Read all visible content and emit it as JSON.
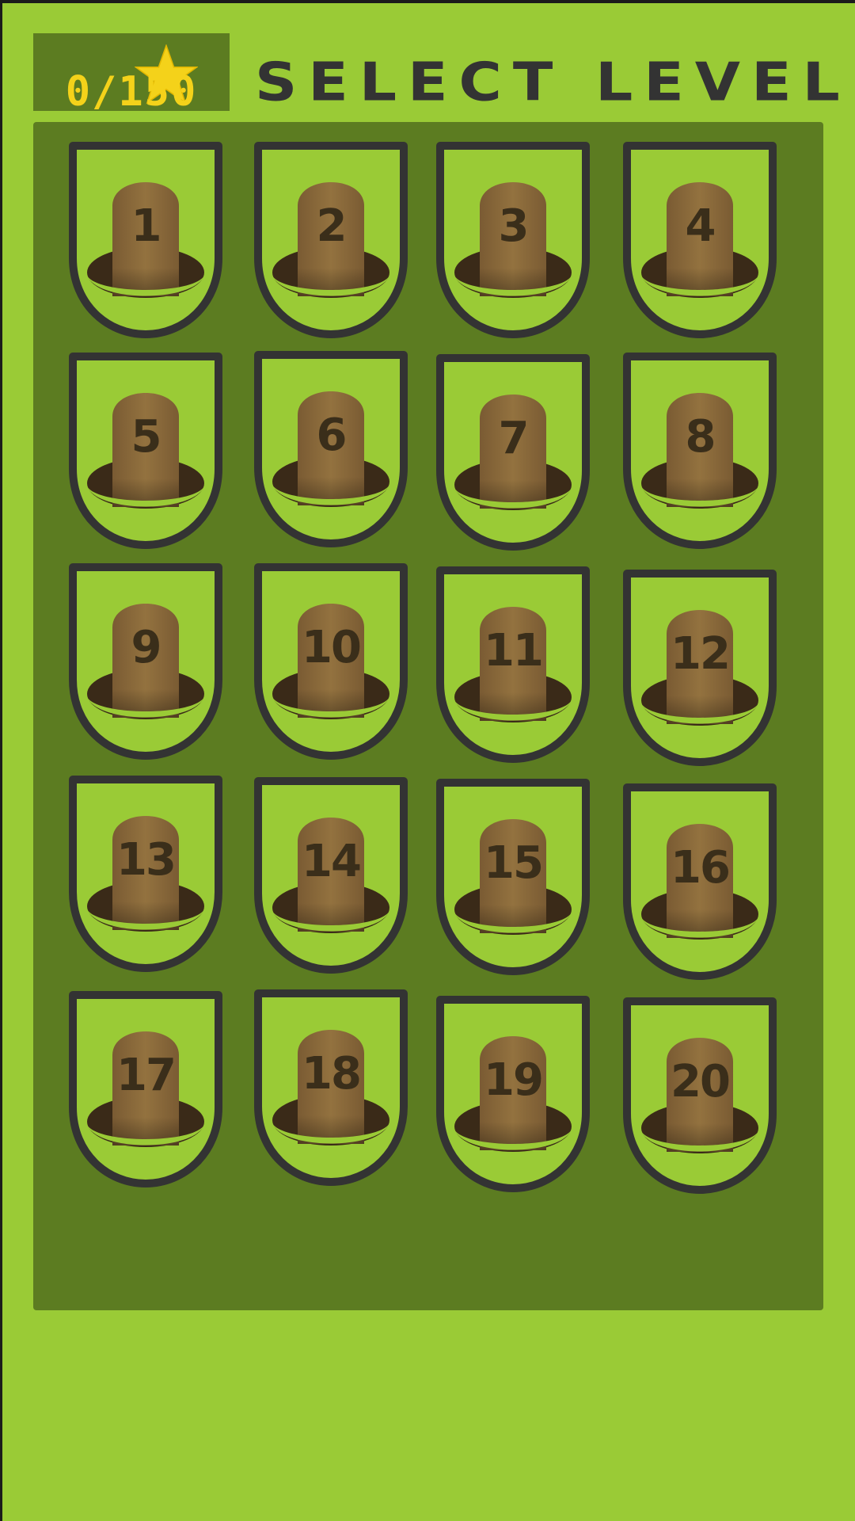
{
  "header": {
    "title": "SELECT LEVEL",
    "stars": {
      "icon": "star-icon",
      "count_text": "0/150",
      "color": "#f4d21a"
    }
  },
  "levels": [
    {
      "number": "1"
    },
    {
      "number": "2"
    },
    {
      "number": "3"
    },
    {
      "number": "4"
    },
    {
      "number": "5"
    },
    {
      "number": "6"
    },
    {
      "number": "7"
    },
    {
      "number": "8"
    },
    {
      "number": "9"
    },
    {
      "number": "10"
    },
    {
      "number": "11"
    },
    {
      "number": "12"
    },
    {
      "number": "13"
    },
    {
      "number": "14"
    },
    {
      "number": "15"
    },
    {
      "number": "16"
    },
    {
      "number": "17"
    },
    {
      "number": "18"
    },
    {
      "number": "19"
    },
    {
      "number": "20"
    }
  ],
  "colors": {
    "background": "#9acb36",
    "panel": "#5c7c21",
    "tile_fill": "#9acb36",
    "tile_border": "#333333",
    "mole": "#8a6a3e",
    "hole": "#3a2a18"
  }
}
